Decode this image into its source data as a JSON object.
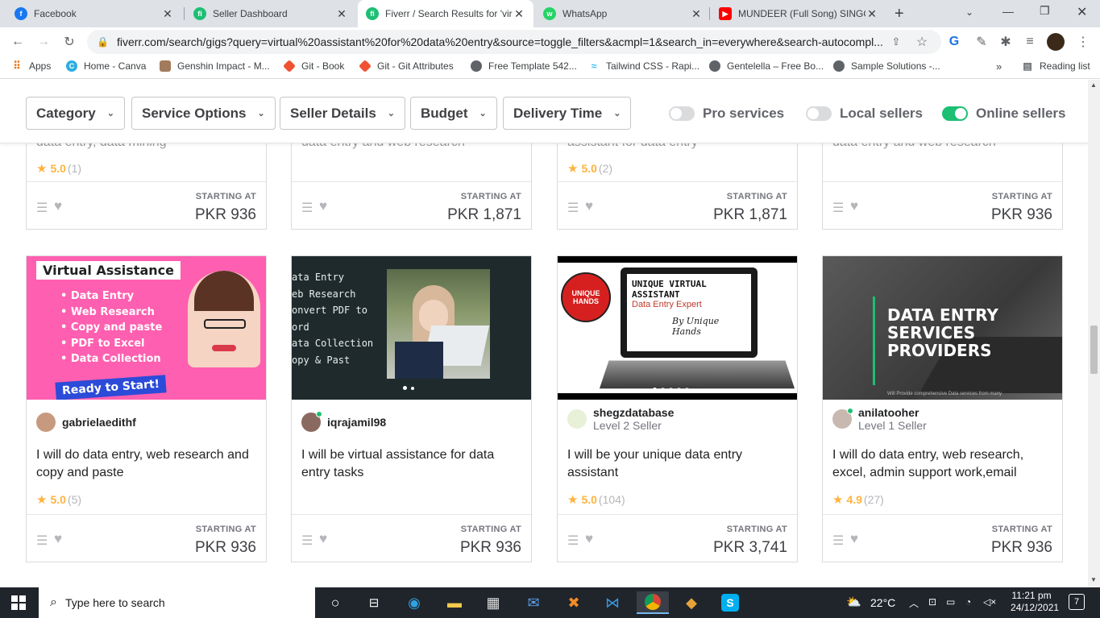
{
  "tabs": [
    {
      "title": "Facebook",
      "icon": "facebook-icon",
      "color": "#1877f2",
      "glyph": "f"
    },
    {
      "title": "Seller Dashboard",
      "icon": "fiverr-icon",
      "color": "#1dbf73",
      "glyph": "fi"
    },
    {
      "title": "Fiverr / Search Results for 'vir",
      "icon": "fiverr-icon",
      "color": "#1dbf73",
      "glyph": "fi"
    },
    {
      "title": "WhatsApp",
      "icon": "whatsapp-icon",
      "color": "#25d366",
      "glyph": "w"
    },
    {
      "title": "MUNDEER (Full Song) SINGG",
      "icon": "youtube-icon",
      "color": "#ff0000",
      "glyph": "▶"
    }
  ],
  "url": "fiverr.com/search/gigs?query=virtual%20assistant%20for%20data%20entry&source=toggle_filters&acmpl=1&search_in=everywhere&search-autocompl...",
  "bookmarks": [
    {
      "label": "Apps",
      "icon": "apps-grid-icon"
    },
    {
      "label": "Home - Canva",
      "icon": "canva-icon"
    },
    {
      "label": "Genshin Impact - M...",
      "icon": "genshin-icon"
    },
    {
      "label": "Git - Book",
      "icon": "git-icon"
    },
    {
      "label": "Git - Git Attributes",
      "icon": "git-icon"
    },
    {
      "label": "Free Template 542...",
      "icon": "globe-icon"
    },
    {
      "label": "Tailwind CSS - Rapi...",
      "icon": "tailwind-icon"
    },
    {
      "label": "Gentelella – Free Bo...",
      "icon": "globe-icon"
    },
    {
      "label": "Sample Solutions -...",
      "icon": "globe-icon"
    }
  ],
  "reading_list": "Reading list",
  "filters": [
    "Category",
    "Service Options",
    "Seller Details",
    "Budget",
    "Delivery Time"
  ],
  "toggles": [
    {
      "label": "Pro services",
      "on": false
    },
    {
      "label": "Local sellers",
      "on": false
    },
    {
      "label": "Online sellers",
      "on": true
    }
  ],
  "top_row": [
    {
      "title_tail": "data entry, data mining",
      "rating": "5.0",
      "count": "(1)",
      "starting": "STARTING AT",
      "price": "PKR 936"
    },
    {
      "title_tail": "data entry and web research",
      "rating": "",
      "count": "",
      "starting": "STARTING AT",
      "price": "PKR 1,871"
    },
    {
      "title_tail": "assistant for data entry",
      "rating": "5.0",
      "count": "(2)",
      "starting": "STARTING AT",
      "price": "PKR 1,871"
    },
    {
      "title_tail": "data entry and web research",
      "rating": "",
      "count": "",
      "starting": "STARTING AT",
      "price": "PKR 936"
    }
  ],
  "gigs": [
    {
      "seller": "gabrielaedithf",
      "level": "",
      "title": "I will do data entry, web research and copy and paste",
      "rating": "5.0",
      "count": "(5)",
      "starting": "STARTING AT",
      "price": "PKR 936",
      "thumb": {
        "heading": "Virtual Assistance",
        "bullets": [
          "Data Entry",
          "Web Research",
          "Copy and paste",
          "PDF to Excel",
          "Data Collection"
        ],
        "cta": "Ready to Start!"
      }
    },
    {
      "seller": "iqrajamil98",
      "level": "",
      "title": "I will be virtual assistance for data entry tasks",
      "rating": "",
      "count": "",
      "starting": "STARTING AT",
      "price": "PKR 936",
      "thumb": {
        "lines": [
          "ata  Entry",
          "eb Research",
          "onvert PDF to",
          "ord",
          "ata Collection",
          "opy & Past"
        ]
      }
    },
    {
      "seller": "shegzdatabase",
      "level": "Level 2 Seller",
      "title": "I will be your unique data entry assistant",
      "rating": "5.0",
      "count": "(104)",
      "starting": "STARTING AT",
      "price": "PKR 3,741",
      "thumb": {
        "l1": "UNIQUE VIRTUAL",
        "l2": "ASSISTANT",
        "l3": "Data Entry Expert",
        "l4": "By Unique Hands",
        "logo": "UNIQUE HANDS"
      }
    },
    {
      "seller": "anilatooher",
      "level": "Level 1 Seller",
      "title": "I will do data entry, web research, excel, admin support work,email",
      "rating": "4.9",
      "count": "(27)",
      "starting": "STARTING AT",
      "price": "PKR 936",
      "thumb": {
        "l1": "DATA ENTRY",
        "l2": "SERVICES",
        "l3": "PROVIDERS",
        "sub": "Will Provide comprehensive Data services from many"
      }
    }
  ],
  "taskbar": {
    "search_placeholder": "Type here to search",
    "temperature": "22°C",
    "time": "11:21 pm",
    "date": "24/12/2021",
    "notifications": "7"
  }
}
